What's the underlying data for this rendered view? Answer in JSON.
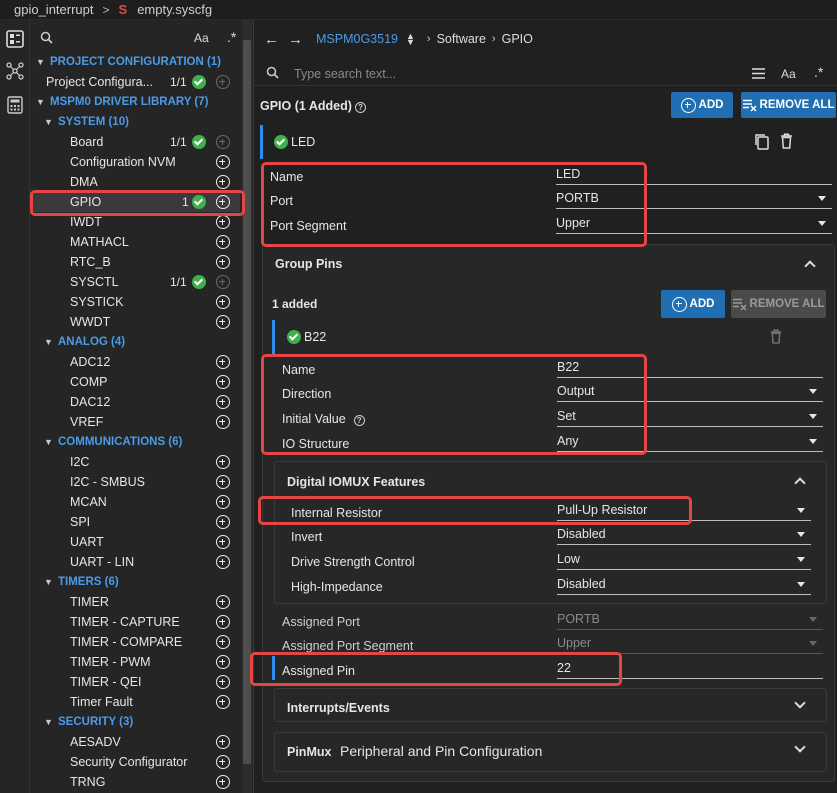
{
  "topbar": {
    "project": "gpio_interrupt",
    "file": "empty.syscfg",
    "file_badge": "S"
  },
  "nav": {
    "rows": [
      {
        "kind": "section",
        "label": "PROJECT CONFIGURATION (1)",
        "indent": 1
      },
      {
        "kind": "item",
        "label": "Project Configura...",
        "count": "1/1",
        "check": true,
        "plus": "dim",
        "indent": 2
      },
      {
        "kind": "section",
        "label": "MSPM0 DRIVER LIBRARY (7)",
        "indent": 1
      },
      {
        "kind": "section",
        "label": "SYSTEM (10)",
        "indent": 2
      },
      {
        "kind": "item",
        "label": "Board",
        "count": "1/1",
        "check": true,
        "plus": "dim",
        "indent": 3
      },
      {
        "kind": "item",
        "label": "Configuration NVM",
        "plus": "on",
        "indent": 3
      },
      {
        "kind": "item",
        "label": "DMA",
        "plus": "on",
        "indent": 3
      },
      {
        "kind": "item",
        "label": "GPIO",
        "count": "1",
        "check": true,
        "plus": "on",
        "indent": 3,
        "selected": true
      },
      {
        "kind": "item",
        "label": "IWDT",
        "plus": "on",
        "indent": 3
      },
      {
        "kind": "item",
        "label": "MATHACL",
        "plus": "on",
        "indent": 3
      },
      {
        "kind": "item",
        "label": "RTC_B",
        "plus": "on",
        "indent": 3
      },
      {
        "kind": "item",
        "label": "SYSCTL",
        "count": "1/1",
        "check": true,
        "plus": "dim",
        "indent": 3
      },
      {
        "kind": "item",
        "label": "SYSTICK",
        "plus": "on",
        "indent": 3
      },
      {
        "kind": "item",
        "label": "WWDT",
        "plus": "on",
        "indent": 3
      },
      {
        "kind": "section",
        "label": "ANALOG (4)",
        "indent": 2
      },
      {
        "kind": "item",
        "label": "ADC12",
        "plus": "on",
        "indent": 3
      },
      {
        "kind": "item",
        "label": "COMP",
        "plus": "on",
        "indent": 3
      },
      {
        "kind": "item",
        "label": "DAC12",
        "plus": "on",
        "indent": 3
      },
      {
        "kind": "item",
        "label": "VREF",
        "plus": "on",
        "indent": 3
      },
      {
        "kind": "section",
        "label": "COMMUNICATIONS (6)",
        "indent": 2
      },
      {
        "kind": "item",
        "label": "I2C",
        "plus": "on",
        "indent": 3
      },
      {
        "kind": "item",
        "label": "I2C - SMBUS",
        "plus": "on",
        "indent": 3
      },
      {
        "kind": "item",
        "label": "MCAN",
        "plus": "on",
        "indent": 3
      },
      {
        "kind": "item",
        "label": "SPI",
        "plus": "on",
        "indent": 3
      },
      {
        "kind": "item",
        "label": "UART",
        "plus": "on",
        "indent": 3
      },
      {
        "kind": "item",
        "label": "UART - LIN",
        "plus": "on",
        "indent": 3
      },
      {
        "kind": "section",
        "label": "TIMERS (6)",
        "indent": 2
      },
      {
        "kind": "item",
        "label": "TIMER",
        "plus": "on",
        "indent": 3
      },
      {
        "kind": "item",
        "label": "TIMER - CAPTURE",
        "plus": "on",
        "indent": 3
      },
      {
        "kind": "item",
        "label": "TIMER - COMPARE",
        "plus": "on",
        "indent": 3
      },
      {
        "kind": "item",
        "label": "TIMER - PWM",
        "plus": "on",
        "indent": 3
      },
      {
        "kind": "item",
        "label": "TIMER - QEI",
        "plus": "on",
        "indent": 3
      },
      {
        "kind": "item",
        "label": "Timer Fault",
        "plus": "on",
        "indent": 3
      },
      {
        "kind": "section",
        "label": "SECURITY (3)",
        "indent": 2
      },
      {
        "kind": "item",
        "label": "AESADV",
        "plus": "on",
        "indent": 3
      },
      {
        "kind": "item",
        "label": "Security Configurator",
        "plus": "on",
        "indent": 3
      },
      {
        "kind": "item",
        "label": "TRNG",
        "plus": "on",
        "indent": 3
      }
    ],
    "search_aa": "Aa",
    "search_star": ".*"
  },
  "main": {
    "device": "MSPM0G3519",
    "crumb1": "Software",
    "crumb2": "GPIO",
    "search_placeholder": "Type search text...",
    "search_aa": "Aa",
    "search_star": ".*",
    "title": "GPIO (1 Added)",
    "add_label": "ADD",
    "remove_all_label": "REMOVE ALL",
    "instance_name": "LED",
    "props": {
      "name_label": "Name",
      "name_value": "LED",
      "port_label": "Port",
      "port_value": "PORTB",
      "seg_label": "Port Segment",
      "seg_value": "Upper"
    },
    "group_pins": {
      "title": "Group Pins",
      "added": "1 added",
      "add_label": "ADD",
      "remove_all_label": "REMOVE ALL",
      "pin_name": "B22",
      "props": {
        "name_label": "Name",
        "name_value": "B22",
        "dir_label": "Direction",
        "dir_value": "Output",
        "init_label": "Initial Value",
        "init_value": "Set",
        "io_label": "IO Structure",
        "io_value": "Any"
      },
      "iomux": {
        "title": "Digital IOMUX Features",
        "res_label": "Internal Resistor",
        "res_value": "Pull-Up Resistor",
        "inv_label": "Invert",
        "inv_value": "Disabled",
        "drive_label": "Drive Strength Control",
        "drive_value": "Low",
        "hiz_label": "High-Impedance",
        "hiz_value": "Disabled"
      },
      "assigned": {
        "port_label": "Assigned Port",
        "port_value": "PORTB",
        "seg_label": "Assigned Port Segment",
        "seg_value": "Upper",
        "pin_label": "Assigned Pin",
        "pin_value": "22"
      },
      "interrupts_title": "Interrupts/Events",
      "pinmux_title": "PinMux",
      "pinmux_subtitle": "Peripheral and Pin Configuration"
    }
  },
  "colors": {
    "accent": "#2d8ef0",
    "button": "#1f6fb2",
    "check": "#3fb14a",
    "highlight": "#e64545",
    "section": "#4a9be8"
  }
}
